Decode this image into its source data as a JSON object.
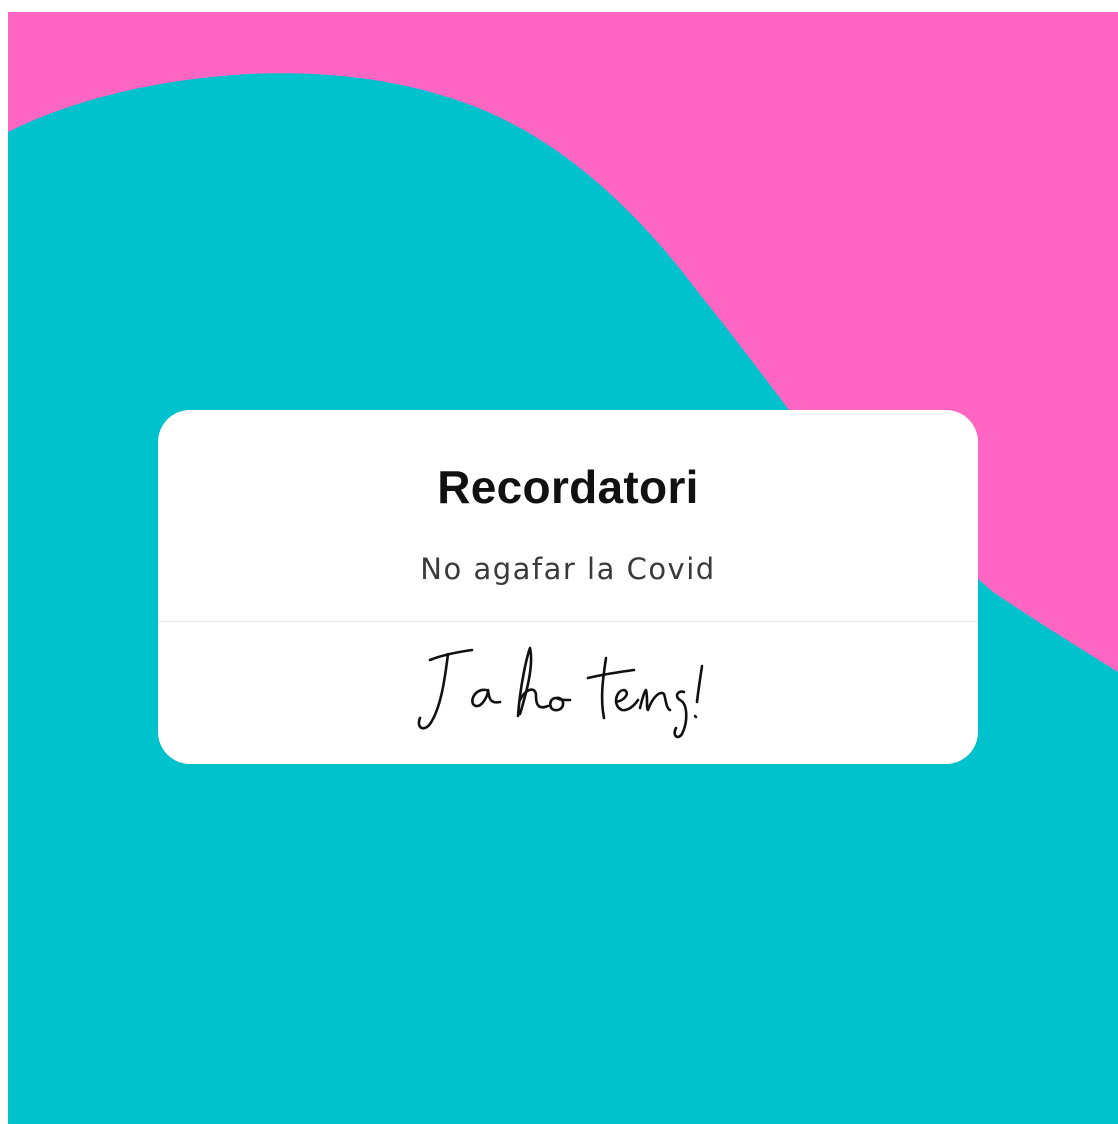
{
  "colors": {
    "pink_background": "#FF66C4",
    "teal_wave": "#00C2CC",
    "card_background": "#FFFFFF",
    "title_text": "#111111",
    "subtitle_text": "#3A3A3A"
  },
  "card": {
    "title": "Recordatori",
    "subtitle": "No agafar la Covid",
    "action_label": "Ja ho tens!"
  }
}
